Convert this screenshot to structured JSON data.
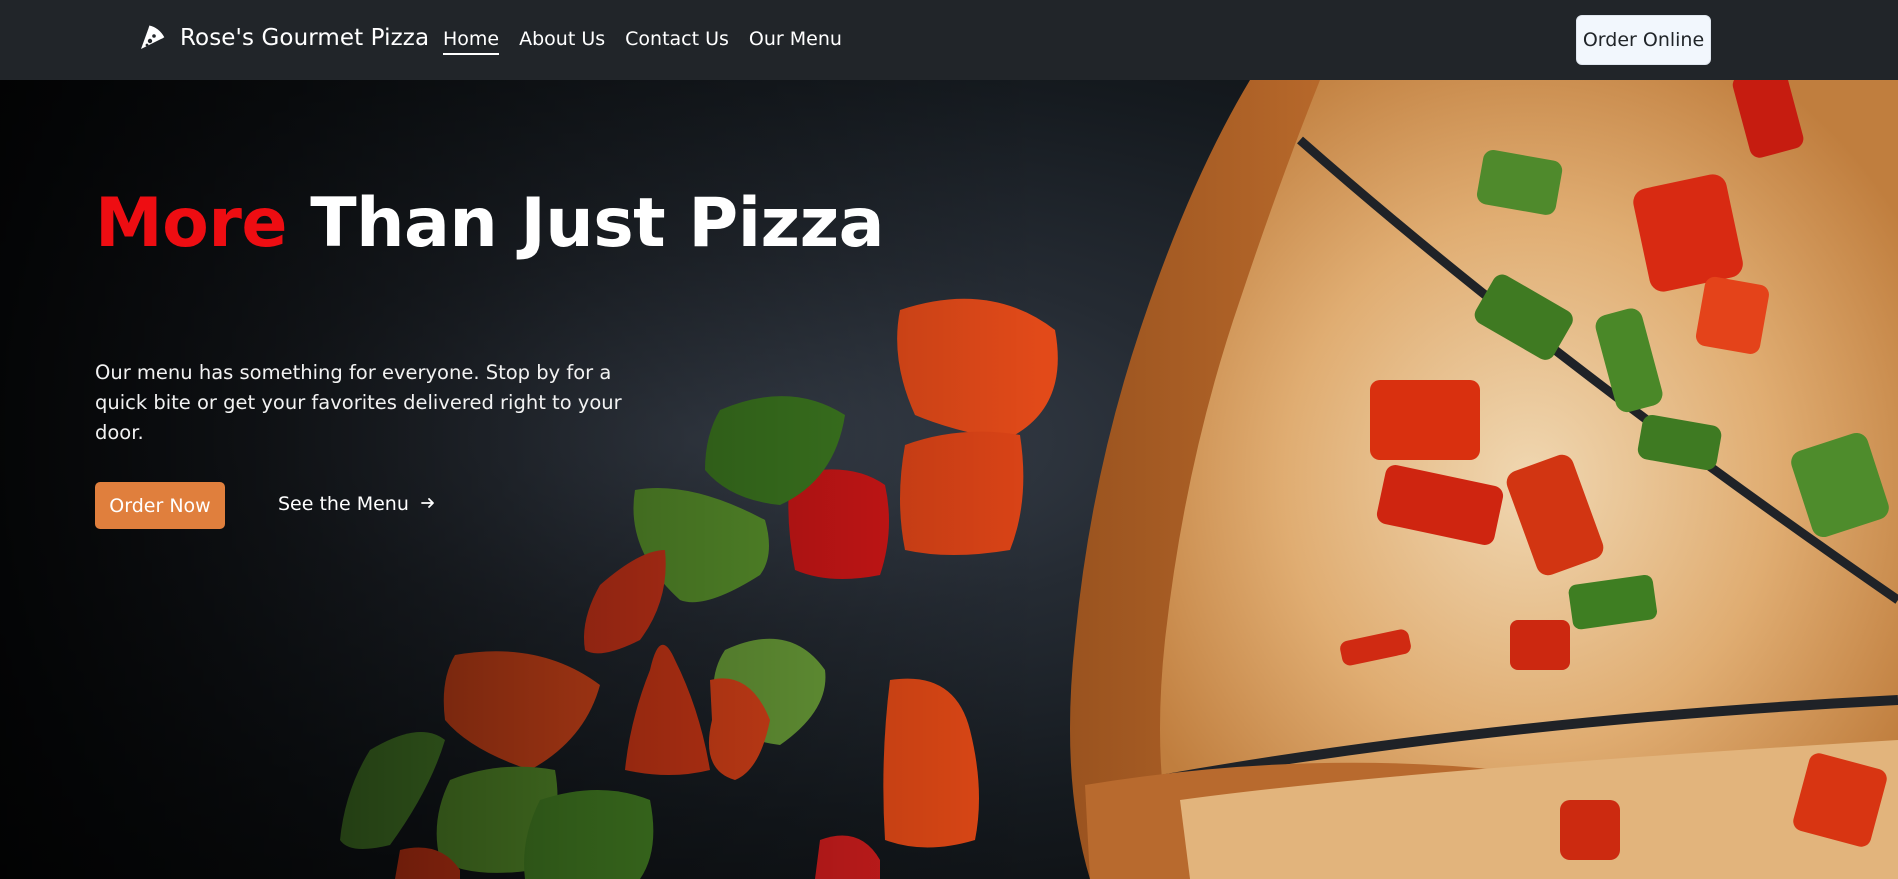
{
  "navbar": {
    "brand_name": "Rose's Gourmet Pizza",
    "brand_icon": "pizza-slice-icon",
    "links": [
      {
        "label": "Home",
        "active": true
      },
      {
        "label": "About Us",
        "active": false
      },
      {
        "label": "Contact Us",
        "active": false
      },
      {
        "label": "Our Menu",
        "active": false
      }
    ],
    "cta_label": "Order Online"
  },
  "hero": {
    "title_accent": "More",
    "title_rest": "Than Just Pizza",
    "description": "Our menu has something for everyone. Stop by for a quick bite or get your favorites delivered right to your door.",
    "primary_button": "Order Now",
    "secondary_link": "See the Menu",
    "secondary_icon": "arrow-right-icon",
    "background_image": "pizza-with-peppers-photo"
  },
  "colors": {
    "navbar_bg": "#212529",
    "accent_red": "#ee0d12",
    "button_orange": "#e07f3d",
    "order_online_bg": "#f2f7fd"
  }
}
